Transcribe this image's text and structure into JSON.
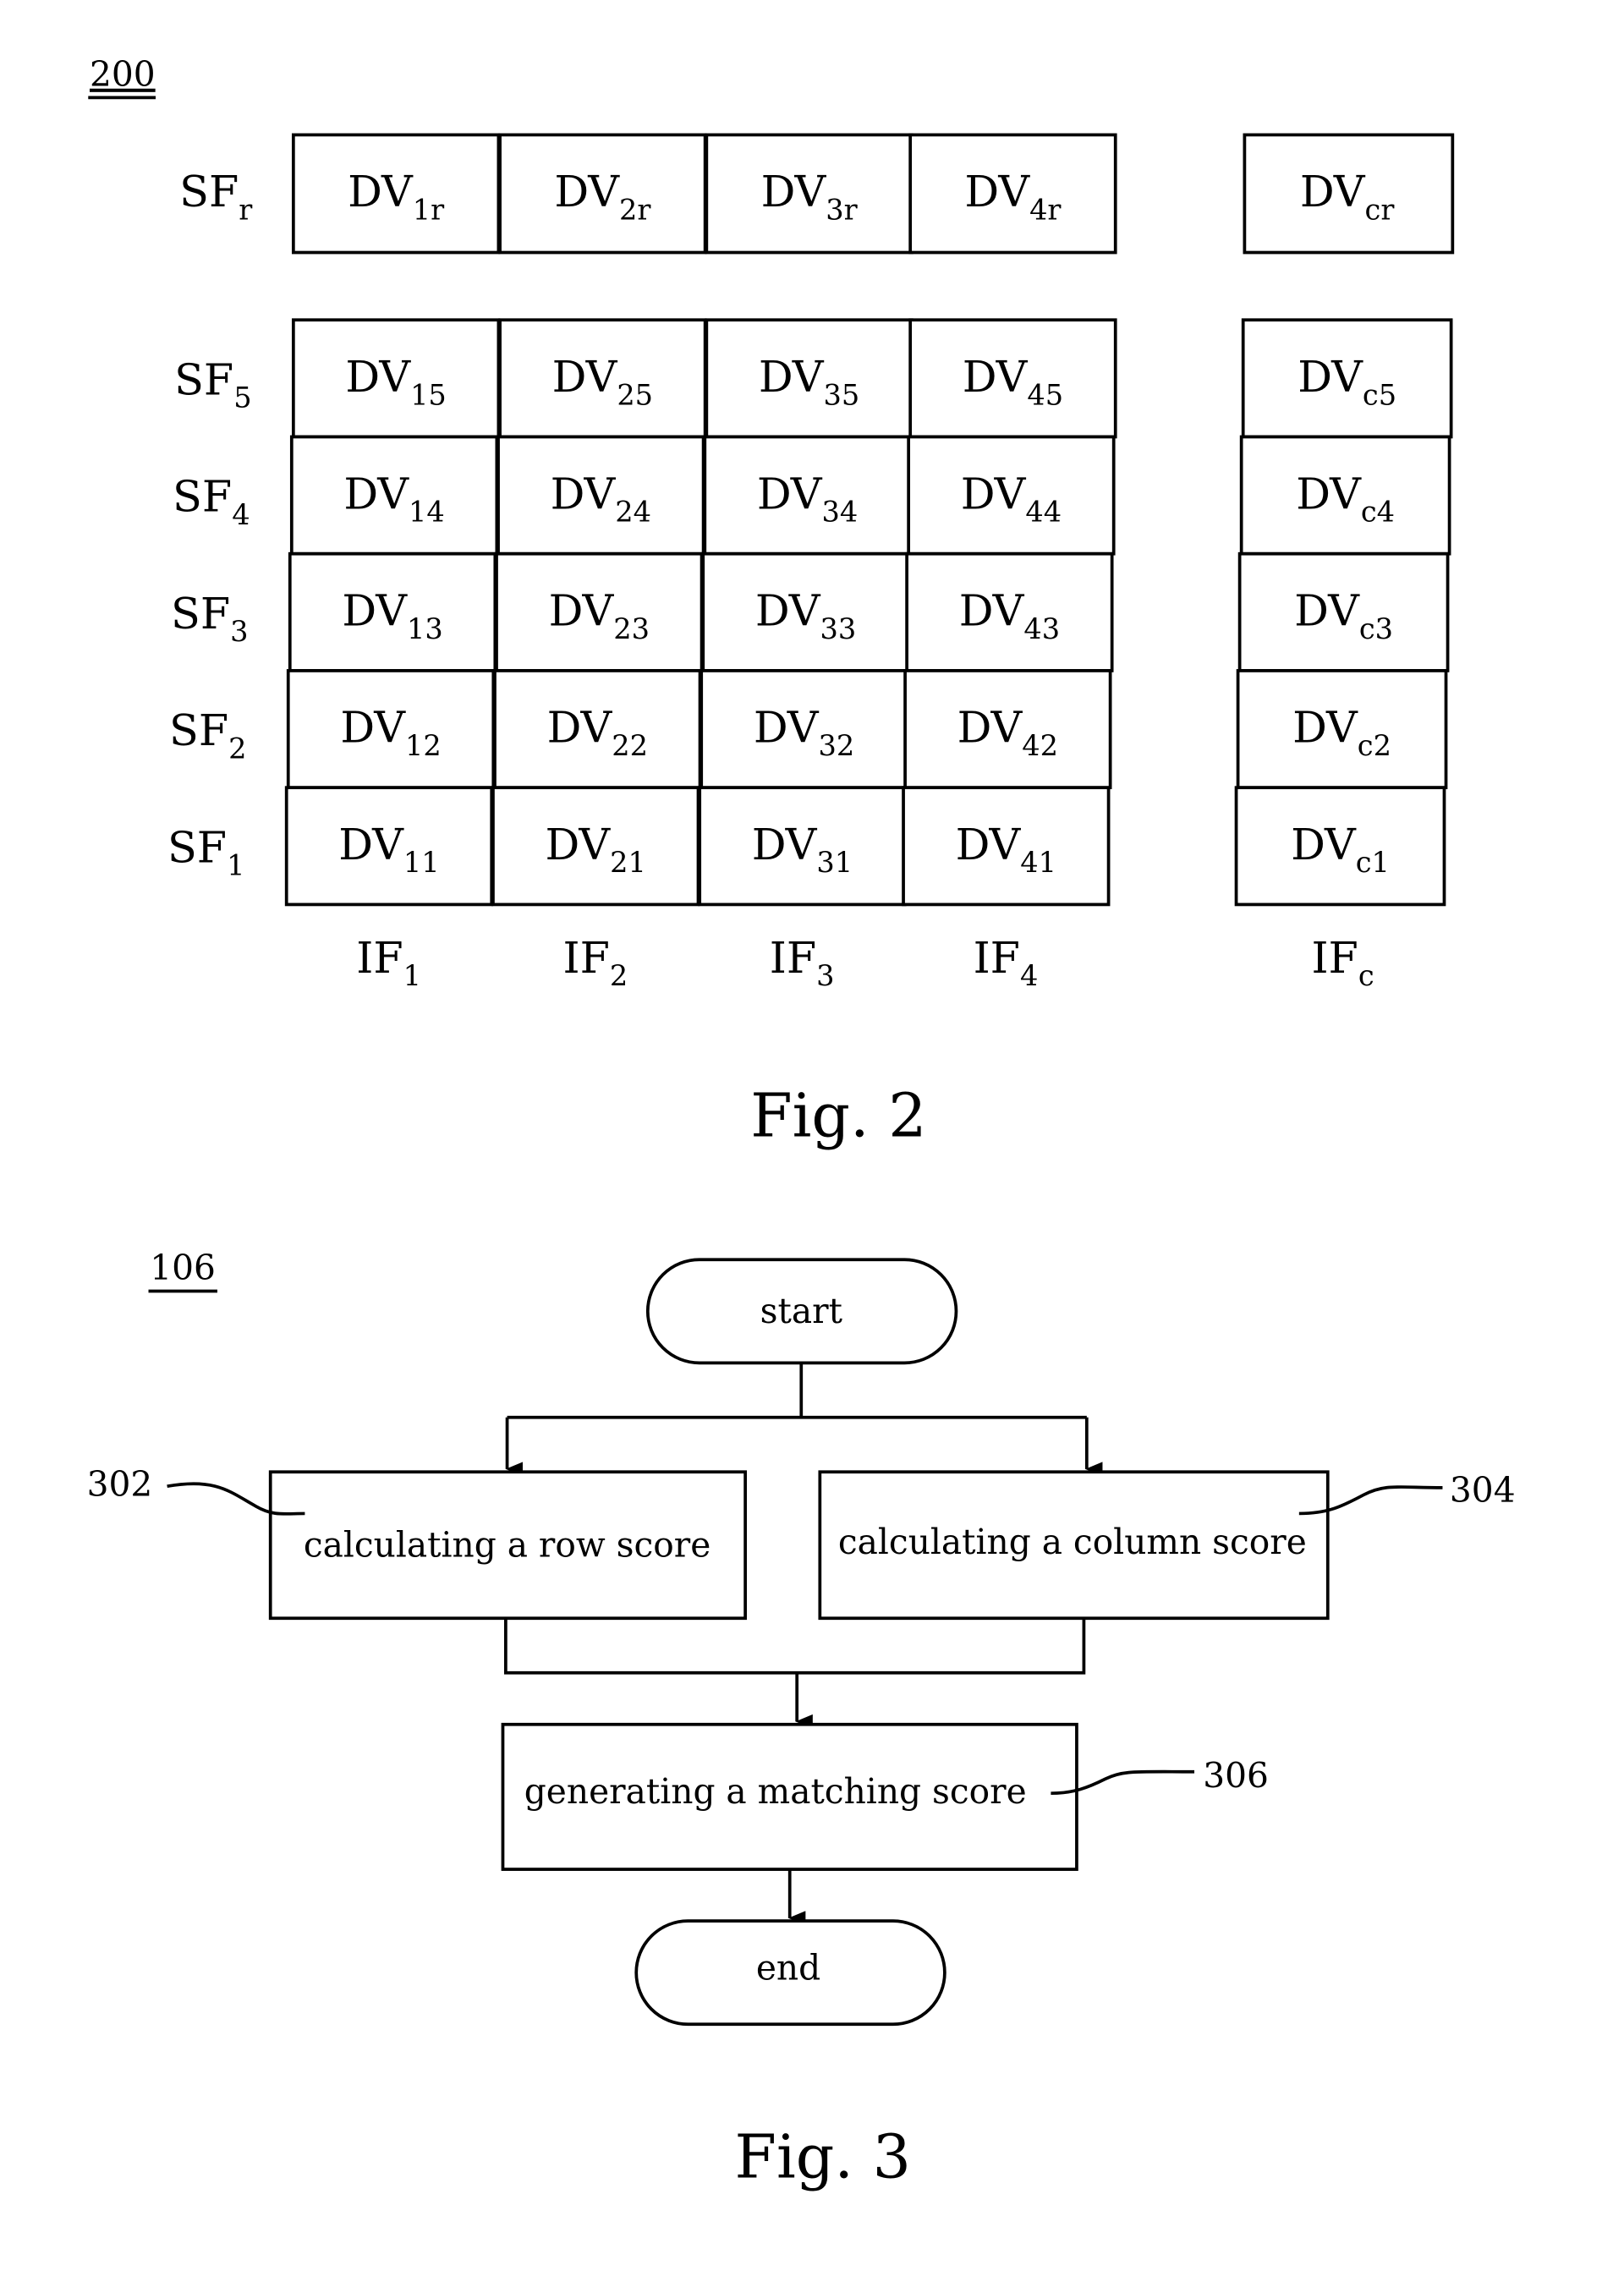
{
  "fig2": {
    "ref": "200",
    "caption": "Fig. 2",
    "row_r": {
      "label": "SF",
      "sub": "r",
      "cells": [
        {
          "b": "DV",
          "s": "1r"
        },
        {
          "b": "DV",
          "s": "2r"
        },
        {
          "b": "DV",
          "s": "3r"
        },
        {
          "b": "DV",
          "s": "4r"
        }
      ],
      "extra": {
        "b": "DV",
        "s": "cr"
      }
    },
    "rows": [
      {
        "label": "SF",
        "sub": "5",
        "cells": [
          {
            "b": "DV",
            "s": "15"
          },
          {
            "b": "DV",
            "s": "25"
          },
          {
            "b": "DV",
            "s": "35"
          },
          {
            "b": "DV",
            "s": "45"
          }
        ],
        "extra": {
          "b": "DV",
          "s": "c5"
        }
      },
      {
        "label": "SF",
        "sub": "4",
        "cells": [
          {
            "b": "DV",
            "s": "14"
          },
          {
            "b": "DV",
            "s": "24"
          },
          {
            "b": "DV",
            "s": "34"
          },
          {
            "b": "DV",
            "s": "44"
          }
        ],
        "extra": {
          "b": "DV",
          "s": "c4"
        }
      },
      {
        "label": "SF",
        "sub": "3",
        "cells": [
          {
            "b": "DV",
            "s": "13"
          },
          {
            "b": "DV",
            "s": "23"
          },
          {
            "b": "DV",
            "s": "33"
          },
          {
            "b": "DV",
            "s": "43"
          }
        ],
        "extra": {
          "b": "DV",
          "s": "c3"
        }
      },
      {
        "label": "SF",
        "sub": "2",
        "cells": [
          {
            "b": "DV",
            "s": "12"
          },
          {
            "b": "DV",
            "s": "22"
          },
          {
            "b": "DV",
            "s": "32"
          },
          {
            "b": "DV",
            "s": "42"
          }
        ],
        "extra": {
          "b": "DV",
          "s": "c2"
        }
      },
      {
        "label": "SF",
        "sub": "1",
        "cells": [
          {
            "b": "DV",
            "s": "11"
          },
          {
            "b": "DV",
            "s": "21"
          },
          {
            "b": "DV",
            "s": "31"
          },
          {
            "b": "DV",
            "s": "41"
          }
        ],
        "extra": {
          "b": "DV",
          "s": "c1"
        }
      }
    ],
    "cols": [
      {
        "b": "IF",
        "s": "1"
      },
      {
        "b": "IF",
        "s": "2"
      },
      {
        "b": "IF",
        "s": "3"
      },
      {
        "b": "IF",
        "s": "4"
      }
    ],
    "col_extra": {
      "b": "IF",
      "s": "c"
    }
  },
  "fig3": {
    "ref": "106",
    "caption": "Fig. 3",
    "start": "start",
    "end": "end",
    "step_302": {
      "ref": "302",
      "text": "calculating a row score"
    },
    "step_304": {
      "ref": "304",
      "text": "calculating a column score"
    },
    "step_306": {
      "ref": "306",
      "text": "generating a matching score"
    }
  }
}
